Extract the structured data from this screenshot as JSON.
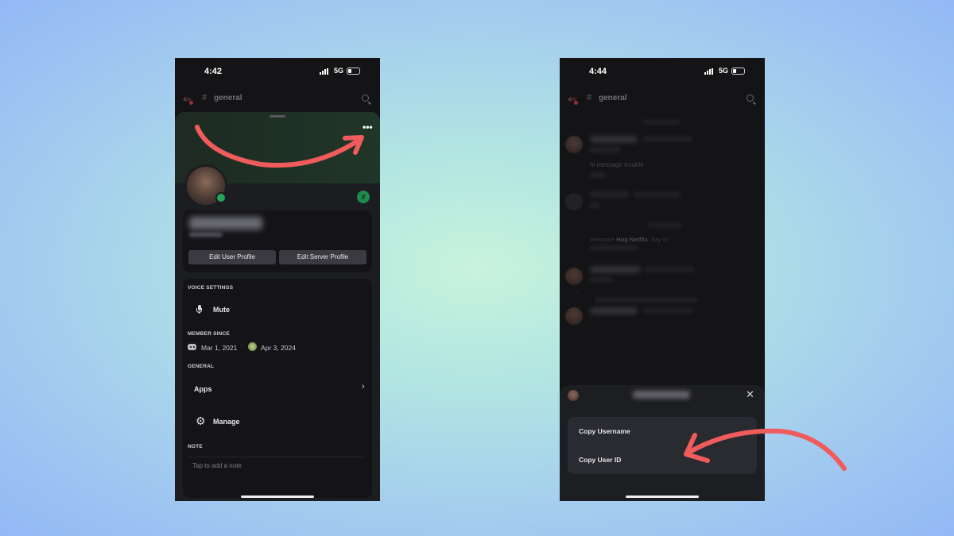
{
  "colors": {
    "arrow": "#f05b5b",
    "online": "#23a55a",
    "phone_bg": "#141416"
  },
  "left_phone": {
    "time": "4:42",
    "network": "5G",
    "channel": "general",
    "profile": {
      "edit_user_profile": "Edit User Profile",
      "edit_server_profile": "Edit Server Profile",
      "voice_settings_label": "VOICE SETTINGS",
      "mute_label": "Mute",
      "member_since_label": "MEMBER SINCE",
      "discord_member_since": "Mar 1, 2021",
      "server_member_since": "Apr 3, 2024",
      "general_label": "GENERAL",
      "apps_label": "Apps",
      "manage_label": "Manage",
      "note_label": "NOTE",
      "note_placeholder": "Tap to add a note"
    },
    "icons": [
      "back-arrow-icon",
      "search-icon",
      "more-options-icon",
      "nitro-badge-icon",
      "microphone-icon",
      "discord-icon",
      "server-icon",
      "chevron-right-icon",
      "gear-icon"
    ]
  },
  "right_phone": {
    "time": "4:44",
    "network": "5G",
    "channel": "general",
    "chat": {
      "visible_message": "hi message trouble",
      "welcome_prefix": "Welcome",
      "welcome_name": "Hog Netflix",
      "welcome_suffix": ". Say hi"
    },
    "menu": {
      "copy_username": "Copy Username",
      "copy_user_id": "Copy User ID"
    },
    "icons": [
      "back-arrow-icon",
      "search-icon",
      "close-icon"
    ]
  }
}
